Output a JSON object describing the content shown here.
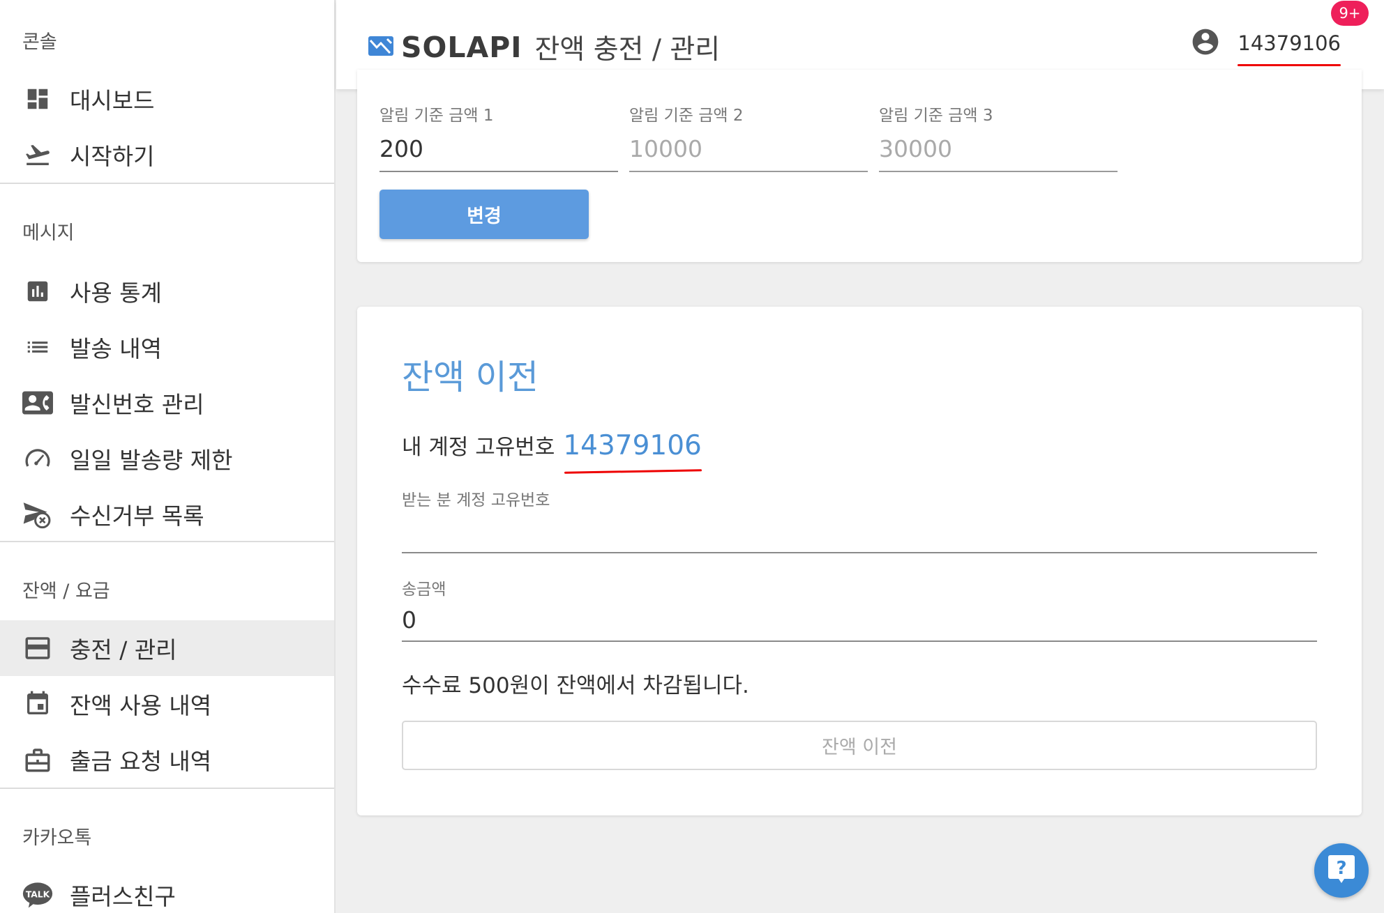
{
  "app": {
    "brand": "SOLAPI",
    "page_title": "잔액 충전 / 관리",
    "user_id": "14379106",
    "notification_badge": "9+"
  },
  "sidebar": {
    "sections": [
      {
        "header": "콘솔",
        "items": [
          {
            "label": "대시보드",
            "icon": "dashboard-icon"
          },
          {
            "label": "시작하기",
            "icon": "takeoff-icon"
          }
        ]
      },
      {
        "header": "메시지",
        "items": [
          {
            "label": "사용 통계",
            "icon": "bar-chart-icon"
          },
          {
            "label": "발송 내역",
            "icon": "list-icon"
          },
          {
            "label": "발신번호 관리",
            "icon": "contact-phone-icon"
          },
          {
            "label": "일일 발송량 제한",
            "icon": "speedometer-icon"
          },
          {
            "label": "수신거부 목록",
            "icon": "send-blocked-icon"
          }
        ]
      },
      {
        "header": "잔액 / 요금",
        "items": [
          {
            "label": "충전 / 관리",
            "icon": "credit-card-icon",
            "active": true
          },
          {
            "label": "잔액 사용 내역",
            "icon": "calendar-icon"
          },
          {
            "label": "출금 요청 내역",
            "icon": "briefcase-icon"
          }
        ]
      },
      {
        "header": "카카오톡",
        "items": [
          {
            "label": "플러스친구",
            "icon": "talk-icon"
          }
        ]
      }
    ]
  },
  "alert_settings": {
    "fields": [
      {
        "label": "알림 기준 금액 1",
        "value": "200"
      },
      {
        "label": "알림 기준 금액 2",
        "value": "10000"
      },
      {
        "label": "알림 기준 금액 3",
        "value": "30000"
      }
    ],
    "change_button": "변경"
  },
  "transfer": {
    "title": "잔액 이전",
    "my_id_label": "내 계정 고유번호",
    "my_id_value": "14379106",
    "recipient_label": "받는 분 계정 고유번호",
    "recipient_value": "",
    "amount_label": "송금액",
    "amount_value": "0",
    "fee_note": "수수료 500원이 잔액에서 차감됩니다.",
    "submit_button": "잔액 이전"
  },
  "colors": {
    "accent": "#5d9be0",
    "title_blue": "#5a9ad8",
    "badge": "#ee1f5a",
    "underline_red": "#e00000",
    "help_button": "#3b8ad6"
  }
}
